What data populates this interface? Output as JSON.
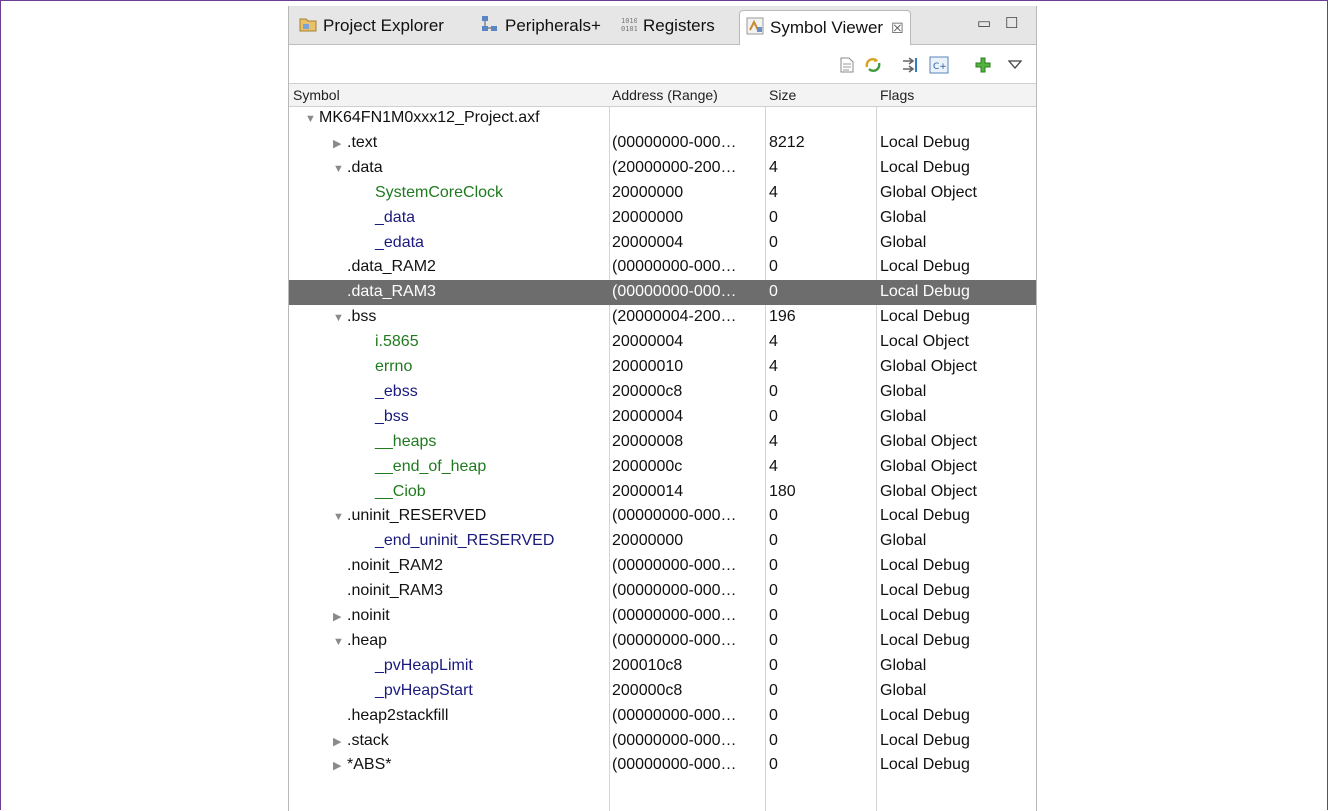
{
  "tabs": [
    {
      "label": "Project Explorer",
      "icon": "project-explorer-icon"
    },
    {
      "label": "Peripherals+",
      "icon": "peripherals-icon"
    },
    {
      "label": "Registers",
      "icon": "registers-icon"
    },
    {
      "label": "Symbol Viewer",
      "icon": "symbol-viewer-icon",
      "active": true,
      "close": "☒"
    }
  ],
  "window_controls": {
    "minimize": "▭",
    "maximize": "☐"
  },
  "toolbar": {
    "icons": [
      "document-icon",
      "sync-icon",
      "link-icon",
      "cpp-icon",
      "add-icon",
      "view-menu-icon"
    ]
  },
  "columns": [
    "Symbol",
    "Address (Range)",
    "Size",
    "Flags"
  ],
  "rows": [
    {
      "indent": 0,
      "toggle": "▼",
      "symbol": "MK64FN1M0xxx12_Project.axf",
      "address": "",
      "size": "",
      "flags": "",
      "color": "black"
    },
    {
      "indent": 1,
      "toggle": "▶",
      "symbol": ".text",
      "address": "(00000000-000…",
      "size": "8212",
      "flags": "Local Debug",
      "color": "black"
    },
    {
      "indent": 1,
      "toggle": "▼",
      "symbol": ".data",
      "address": "(20000000-200…",
      "size": "4",
      "flags": "Local Debug",
      "color": "black"
    },
    {
      "indent": 2,
      "toggle": "",
      "symbol": "SystemCoreClock",
      "address": "20000000",
      "size": "4",
      "flags": "Global Object",
      "color": "green"
    },
    {
      "indent": 2,
      "toggle": "",
      "symbol": "_data",
      "address": "20000000",
      "size": "0",
      "flags": "Global",
      "color": "blue"
    },
    {
      "indent": 2,
      "toggle": "",
      "symbol": "_edata",
      "address": "20000004",
      "size": "0",
      "flags": "Global",
      "color": "blue"
    },
    {
      "indent": 1,
      "toggle": "",
      "symbol": ".data_RAM2",
      "address": "(00000000-000…",
      "size": "0",
      "flags": "Local Debug",
      "color": "black"
    },
    {
      "indent": 1,
      "toggle": "",
      "symbol": ".data_RAM3",
      "address": "(00000000-000…",
      "size": "0",
      "flags": "Local Debug",
      "color": "black",
      "selected": true
    },
    {
      "indent": 1,
      "toggle": "▼",
      "symbol": ".bss",
      "address": "(20000004-200…",
      "size": "196",
      "flags": "Local Debug",
      "color": "black"
    },
    {
      "indent": 2,
      "toggle": "",
      "symbol": "i.5865",
      "address": "20000004",
      "size": "4",
      "flags": "Local Object",
      "color": "green"
    },
    {
      "indent": 2,
      "toggle": "",
      "symbol": "errno",
      "address": "20000010",
      "size": "4",
      "flags": "Global Object",
      "color": "green"
    },
    {
      "indent": 2,
      "toggle": "",
      "symbol": "_ebss",
      "address": "200000c8",
      "size": "0",
      "flags": "Global",
      "color": "blue"
    },
    {
      "indent": 2,
      "toggle": "",
      "symbol": "_bss",
      "address": "20000004",
      "size": "0",
      "flags": "Global",
      "color": "blue"
    },
    {
      "indent": 2,
      "toggle": "",
      "symbol": "__heaps",
      "address": "20000008",
      "size": "4",
      "flags": "Global Object",
      "color": "green"
    },
    {
      "indent": 2,
      "toggle": "",
      "symbol": "__end_of_heap",
      "address": "2000000c",
      "size": "4",
      "flags": "Global Object",
      "color": "green"
    },
    {
      "indent": 2,
      "toggle": "",
      "symbol": "__Ciob",
      "address": "20000014",
      "size": "180",
      "flags": "Global Object",
      "color": "green"
    },
    {
      "indent": 1,
      "toggle": "▼",
      "symbol": ".uninit_RESERVED",
      "address": "(00000000-000…",
      "size": "0",
      "flags": "Local Debug",
      "color": "black"
    },
    {
      "indent": 2,
      "toggle": "",
      "symbol": "_end_uninit_RESERVED",
      "address": "20000000",
      "size": "0",
      "flags": "Global",
      "color": "blue"
    },
    {
      "indent": 1,
      "toggle": "",
      "symbol": ".noinit_RAM2",
      "address": "(00000000-000…",
      "size": "0",
      "flags": "Local Debug",
      "color": "black"
    },
    {
      "indent": 1,
      "toggle": "",
      "symbol": ".noinit_RAM3",
      "address": "(00000000-000…",
      "size": "0",
      "flags": "Local Debug",
      "color": "black"
    },
    {
      "indent": 1,
      "toggle": "▶",
      "symbol": ".noinit",
      "address": "(00000000-000…",
      "size": "0",
      "flags": "Local Debug",
      "color": "black"
    },
    {
      "indent": 1,
      "toggle": "▼",
      "symbol": ".heap",
      "address": "(00000000-000…",
      "size": "0",
      "flags": "Local Debug",
      "color": "black"
    },
    {
      "indent": 2,
      "toggle": "",
      "symbol": "_pvHeapLimit",
      "address": "200010c8",
      "size": "0",
      "flags": "Global",
      "color": "blue"
    },
    {
      "indent": 2,
      "toggle": "",
      "symbol": "_pvHeapStart",
      "address": "200000c8",
      "size": "0",
      "flags": "Global",
      "color": "blue"
    },
    {
      "indent": 1,
      "toggle": "",
      "symbol": ".heap2stackfill",
      "address": "(00000000-000…",
      "size": "0",
      "flags": "Local Debug",
      "color": "black"
    },
    {
      "indent": 1,
      "toggle": "▶",
      "symbol": ".stack",
      "address": "(00000000-000…",
      "size": "0",
      "flags": "Local Debug",
      "color": "black"
    },
    {
      "indent": 1,
      "toggle": "▶",
      "symbol": "*ABS*",
      "address": "(00000000-000…",
      "size": "0",
      "flags": "Local Debug",
      "color": "black"
    }
  ]
}
